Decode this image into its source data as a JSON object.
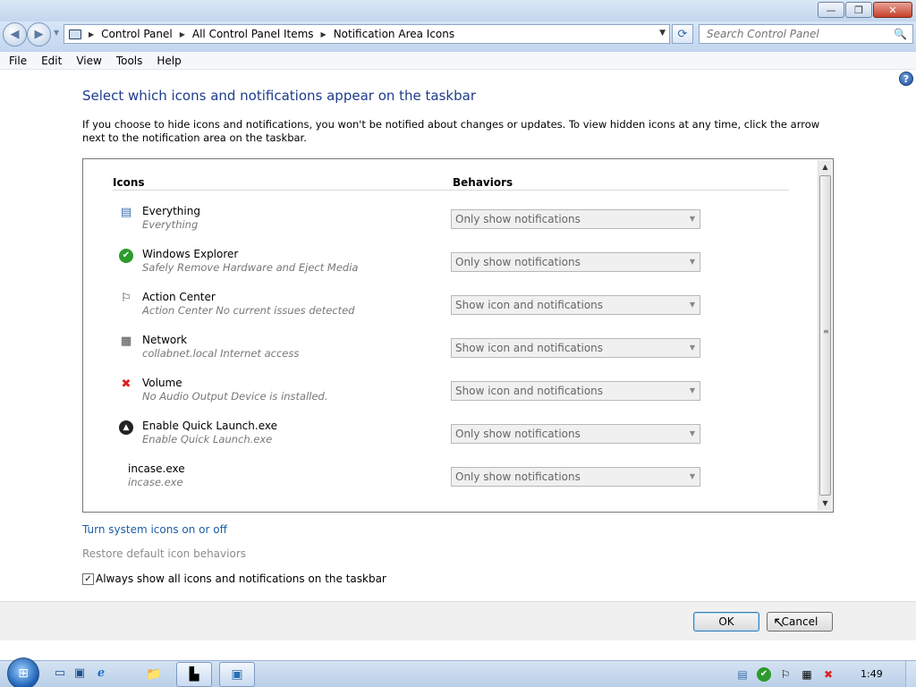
{
  "window": {
    "minimize": "—",
    "maximize": "❐",
    "close": "✕"
  },
  "nav": {
    "back": "◀",
    "forward": "▶"
  },
  "address": {
    "crumbs": [
      "Control Panel",
      "All Control Panel Items",
      "Notification Area Icons"
    ],
    "dropdown": "▼",
    "refresh": "⟳"
  },
  "search": {
    "placeholder": "Search Control Panel",
    "icon": "🔍"
  },
  "menu": [
    "File",
    "Edit",
    "View",
    "Tools",
    "Help"
  ],
  "help_icon": "?",
  "page": {
    "heading": "Select which icons and notifications appear on the taskbar",
    "description": "If you choose to hide icons and notifications, you won't be notified about changes or updates. To view hidden icons at any time, click the arrow next to the notification area on the taskbar.",
    "col_icons": "Icons",
    "col_behaviors": "Behaviors"
  },
  "items": [
    {
      "name": "Everything",
      "sub": "Everything",
      "behavior": "Only show notifications",
      "icon": "everything-icon",
      "glyph": "▤"
    },
    {
      "name": "Windows Explorer",
      "sub": "Safely Remove Hardware and Eject Media",
      "behavior": "Only show notifications",
      "icon": "safely-remove-icon",
      "glyph": "✔"
    },
    {
      "name": "Action Center",
      "sub": "Action Center  No current issues detected",
      "behavior": "Show icon and notifications",
      "icon": "flag-icon",
      "glyph": "⚐"
    },
    {
      "name": "Network",
      "sub": "collabnet.local Internet access",
      "behavior": "Show icon and notifications",
      "icon": "network-icon",
      "glyph": "▦"
    },
    {
      "name": "Volume",
      "sub": "No Audio Output Device is installed.",
      "behavior": "Show icon and notifications",
      "icon": "volume-muted-icon",
      "glyph": "✖"
    },
    {
      "name": "Enable Quick Launch.exe",
      "sub": "Enable Quick Launch.exe",
      "behavior": "Only show notifications",
      "icon": "quick-launch-icon",
      "glyph": "▲"
    },
    {
      "name": "incase.exe",
      "sub": "incase.exe",
      "behavior": "Only show notifications",
      "icon": "",
      "glyph": ""
    }
  ],
  "dropdown_arrow": "▼",
  "scroll": {
    "up": "▲",
    "down": "▼",
    "grip": "≡"
  },
  "links": {
    "turn_system_icons": "Turn system icons on or off",
    "restore_defaults": "Restore default icon behaviors"
  },
  "checkbox": {
    "label": "Always show all icons and notifications on the taskbar",
    "checked": true,
    "mark": "✓"
  },
  "buttons": {
    "ok": "OK",
    "cancel": "Cancel"
  },
  "taskbar": {
    "start": "⊞",
    "quick_launch": [
      {
        "name": "show-desktop-icon",
        "glyph": "▭"
      },
      {
        "name": "switch-windows-icon",
        "glyph": "▣"
      },
      {
        "name": "internet-explorer-icon",
        "glyph": "ℯ"
      }
    ],
    "tasks": [
      {
        "name": "explorer-folder-icon",
        "glyph": "📁"
      },
      {
        "name": "control-panel-icon",
        "glyph": "▙"
      },
      {
        "name": "app-window-icon",
        "glyph": "▣"
      }
    ],
    "tray": [
      {
        "name": "everything-tray-icon",
        "glyph": "▤"
      },
      {
        "name": "safely-remove-tray-icon",
        "glyph": "✔"
      },
      {
        "name": "action-center-tray-icon",
        "glyph": "⚐"
      },
      {
        "name": "network-tray-icon",
        "glyph": "▦"
      },
      {
        "name": "volume-tray-icon",
        "glyph": "✖"
      }
    ],
    "clock": "1:49"
  },
  "colors": {
    "heading": "#1e3c8c",
    "link": "#1c5fa8",
    "disabled_link": "#8c8c8c"
  }
}
